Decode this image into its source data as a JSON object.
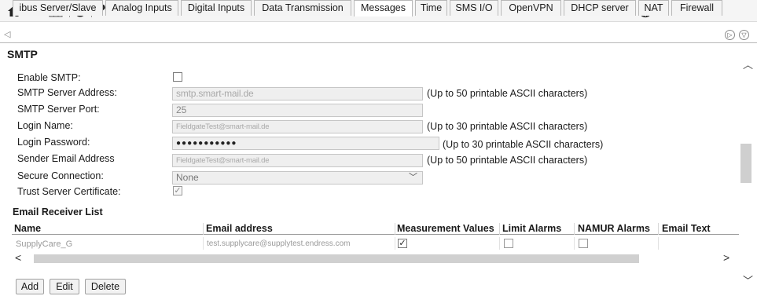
{
  "toolbar": {
    "icons": [
      "home-icon",
      "pencil-icon",
      "grid-icon",
      "refresh-icon",
      "help-icon"
    ],
    "help_label": "?",
    "language_icon": "globe-icon",
    "language_caret": "▾"
  },
  "tabs": [
    {
      "label": "ibus Server/Slave"
    },
    {
      "label": "Analog Inputs"
    },
    {
      "label": "Digital Inputs"
    },
    {
      "label": "Data Transmission"
    },
    {
      "label": "Messages"
    },
    {
      "label": "Time"
    },
    {
      "label": "SMS I/O"
    },
    {
      "label": "OpenVPN"
    },
    {
      "label": "DHCP server"
    },
    {
      "label": "NAT"
    },
    {
      "label": "Firewall"
    }
  ],
  "active_tab": "Messages",
  "section": {
    "title": "SMTP"
  },
  "form": {
    "enable_smtp": {
      "label": "Enable SMTP:",
      "checked": false
    },
    "server_address": {
      "label": "SMTP Server Address:",
      "value": "smtp.smart-mail.de",
      "hint": "(Up to 50 printable ASCII characters)"
    },
    "server_port": {
      "label": "SMTP Server Port:",
      "value": "25"
    },
    "login_name": {
      "label": "Login Name:",
      "value": "FieldgateTest@smart-mail.de",
      "hint": "(Up to 30 printable ASCII characters)"
    },
    "login_password": {
      "label": "Login Password:",
      "value": "●●●●●●●●●●●",
      "hint": "(Up to 30 printable ASCII characters)"
    },
    "sender_email": {
      "label": "Sender Email Address",
      "value": "FieldgateTest@smart-mail.de",
      "hint": "(Up to 50 printable ASCII characters)"
    },
    "secure_connection": {
      "label": "Secure Connection:",
      "value": "None"
    },
    "trust_certificate": {
      "label": "Trust Server Certificate:",
      "checked": true,
      "check_glyph": "✓"
    }
  },
  "receiver_list": {
    "title": "Email Receiver List",
    "columns": [
      "Name",
      "Email address",
      "Measurement Values",
      "Limit Alarms",
      "NAMUR Alarms",
      "Email Text"
    ],
    "rows": [
      {
        "name": "SupplyCare_G",
        "email": "test.supplycare@supplytest.endress.com",
        "measurement_values": true,
        "limit_alarms": false,
        "namur_alarms": false,
        "email_text": ""
      }
    ],
    "check_glyph": "✓"
  },
  "buttons": {
    "add": "Add",
    "edit": "Edit",
    "delete": "Delete"
  },
  "scroll": {
    "left": "<",
    "right": ">",
    "up": "︿",
    "down": "﹀"
  }
}
